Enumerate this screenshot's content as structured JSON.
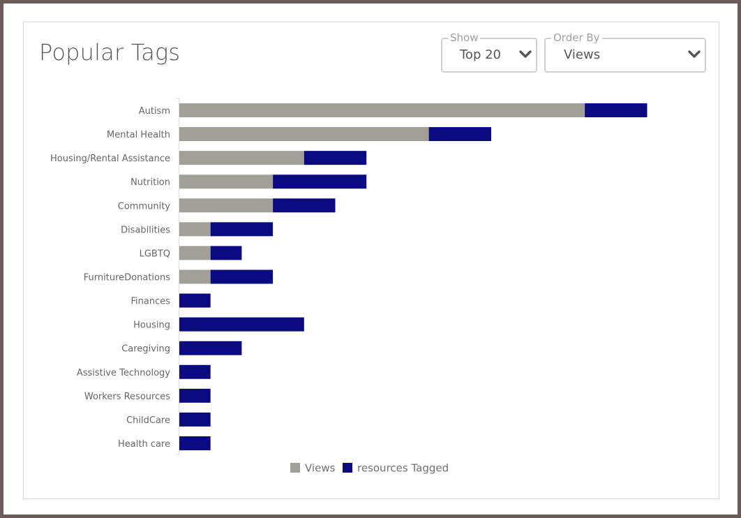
{
  "page": {
    "title": "Popular Tags"
  },
  "filters": {
    "show": {
      "label": "Show",
      "value": "Top 20"
    },
    "order_by": {
      "label": "Order By",
      "value": "Views"
    }
  },
  "icons": {
    "dropdown": "chevron-down-icon"
  },
  "colors": {
    "views": "#a0a099",
    "resources_tagged": "#0b0a80",
    "frame": "#6b5b59"
  },
  "chart_data": {
    "type": "bar",
    "orientation": "horizontal",
    "stacked": true,
    "categories": [
      "Autism",
      "Mental Health",
      "Housing/Rental Assistance",
      "Nutrition",
      "Community",
      "Disabilities",
      "LGBTQ",
      "FurnitureDonations",
      "Finances",
      "Housing",
      "Caregiving",
      "Assistive Technology",
      "Workers Resources",
      "ChildCare",
      "Health care"
    ],
    "series": [
      {
        "name": "Views",
        "color": "#a0a099",
        "values": [
          13,
          8,
          4,
          3,
          3,
          1,
          1,
          1,
          0,
          0,
          0,
          0,
          0,
          0,
          0
        ]
      },
      {
        "name": "resources Tagged",
        "color": "#0b0a80",
        "values": [
          2,
          2,
          2,
          3,
          2,
          2,
          1,
          2,
          1,
          4,
          2,
          1,
          1,
          1,
          1
        ]
      }
    ],
    "xlim": [
      0,
      15
    ],
    "grid": false,
    "legend_position": "bottom"
  }
}
